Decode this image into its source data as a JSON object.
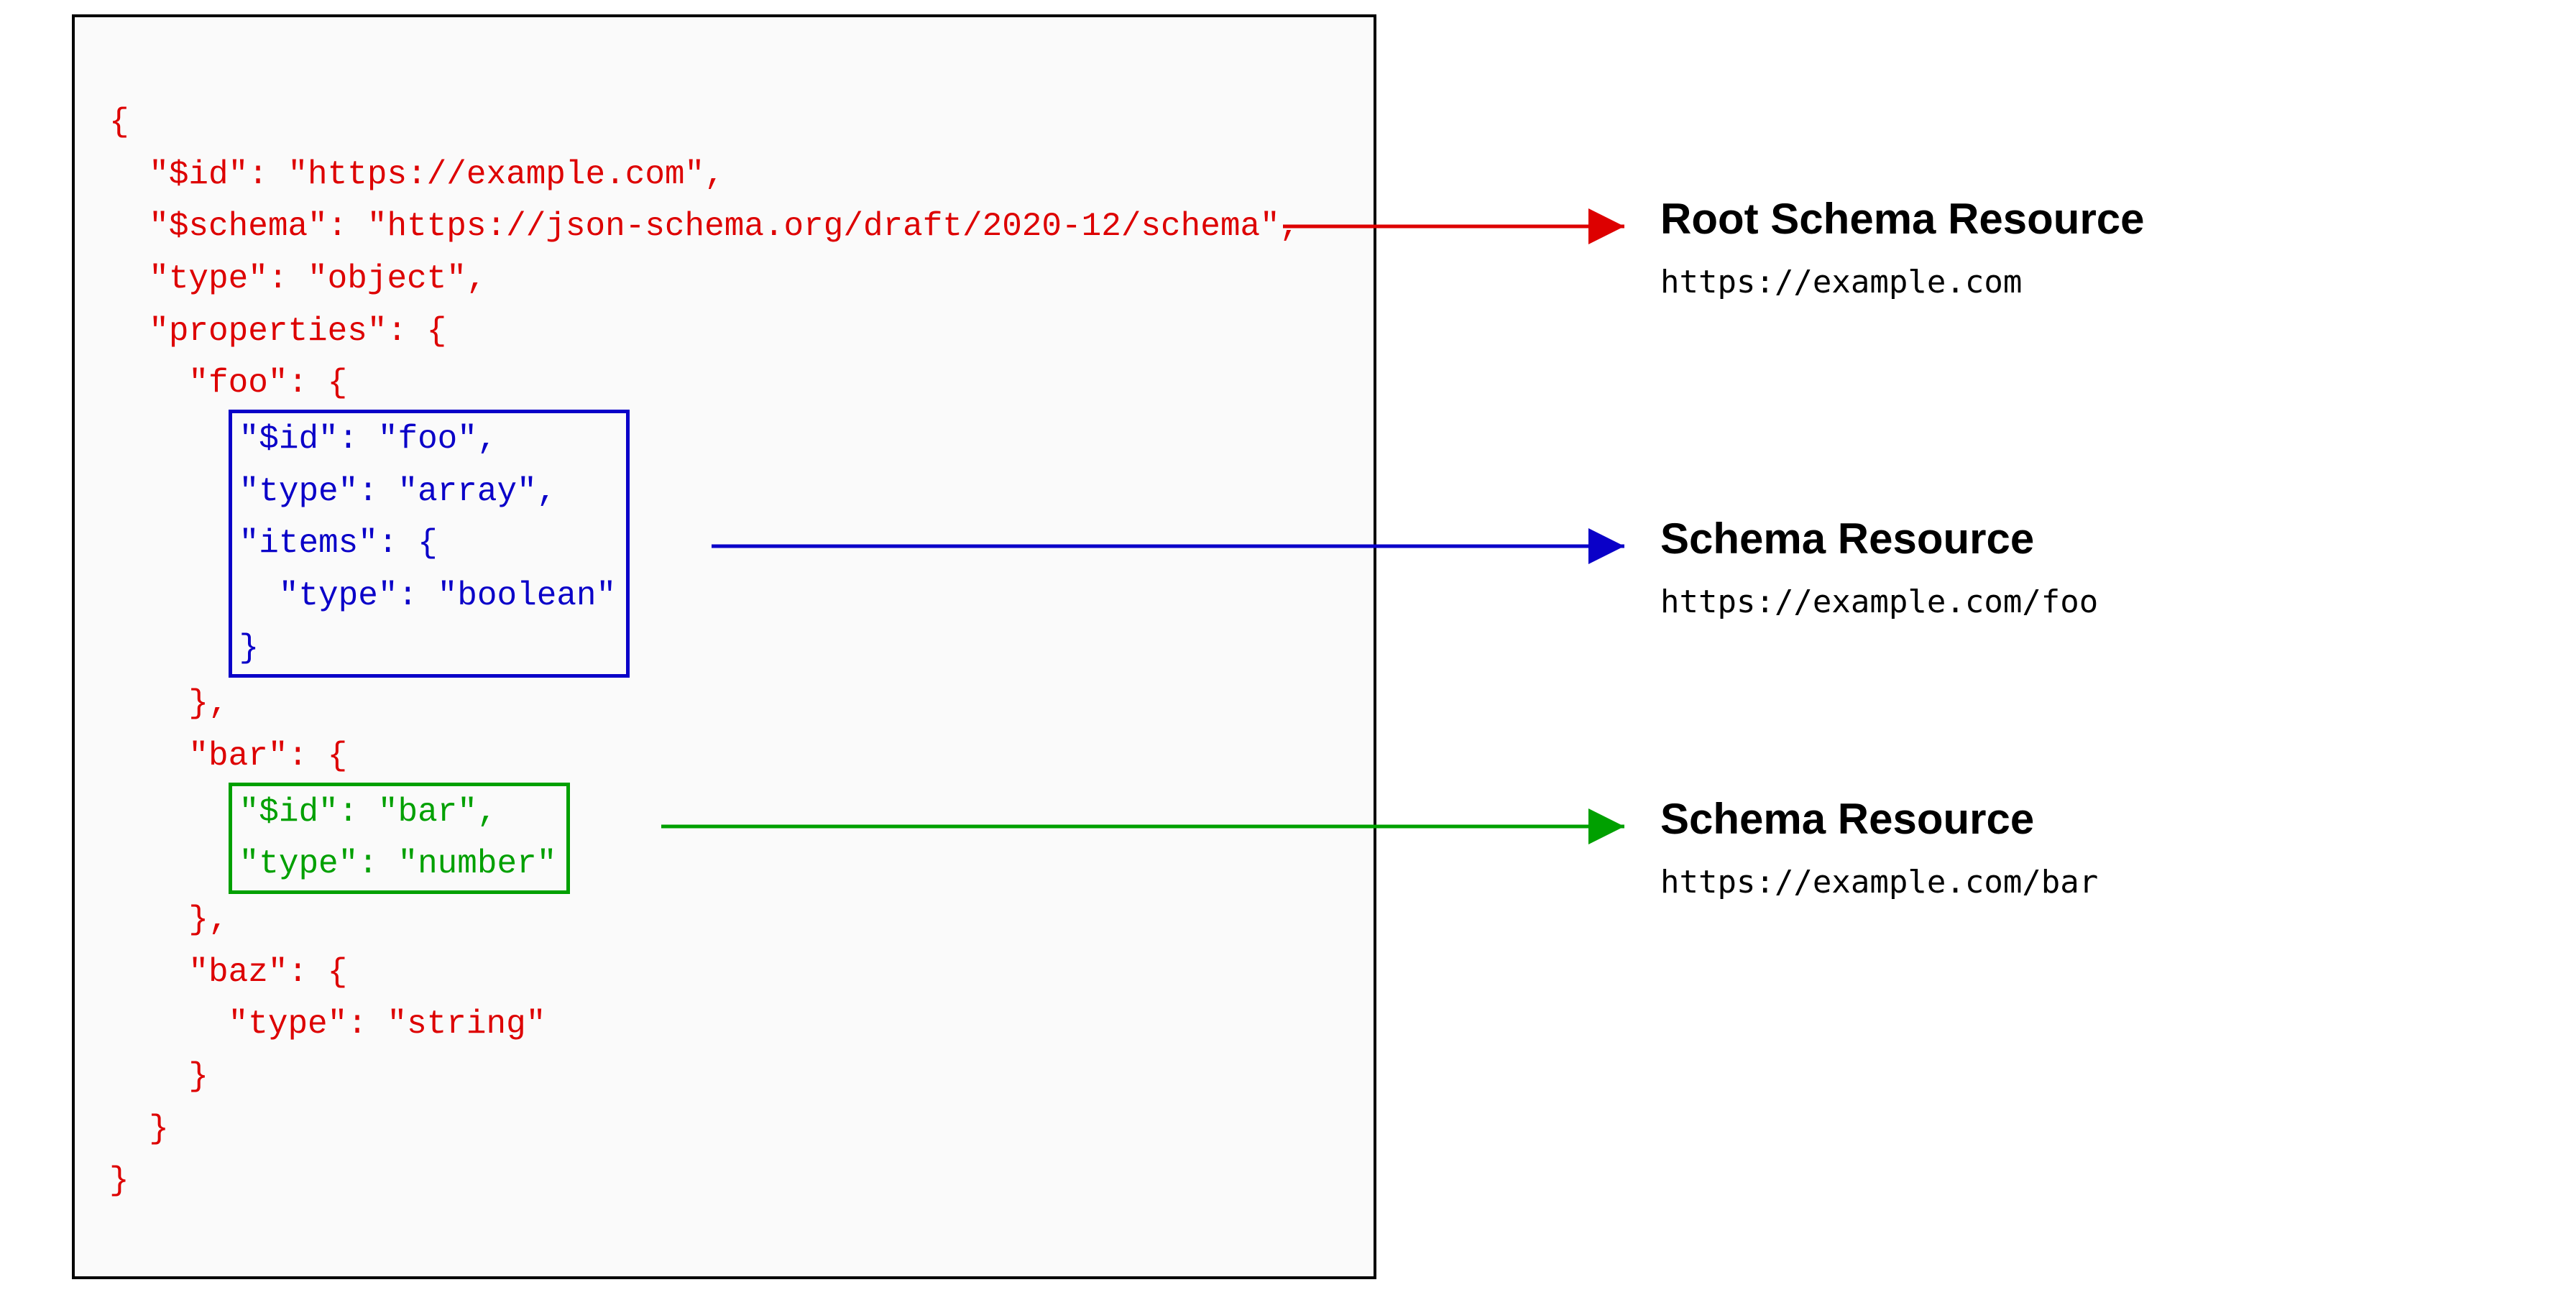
{
  "code": {
    "line1": "{",
    "line2": "  \"$id\": \"https://example.com\",",
    "line3": "  \"$schema\": \"https://json-schema.org/draft/2020-12/schema\",",
    "line4": "  \"type\": \"object\",",
    "line5": "  \"properties\": {",
    "line6": "    \"foo\": {",
    "blue1": "\"$id\": \"foo\",",
    "blue2": "\"type\": \"array\",",
    "blue3": "\"items\": {",
    "blue4": "  \"type\": \"boolean\"",
    "blue5": "}",
    "line7": "    },",
    "line8": "    \"bar\": {",
    "green1": "\"$id\": \"bar\",",
    "green2": "\"type\": \"number\"",
    "line9": "    },",
    "line10": "    \"baz\": {",
    "line11": "      \"type\": \"string\"",
    "line12": "    }",
    "line13": "  }",
    "line14": "}"
  },
  "labels": {
    "root": {
      "title": "Root Schema Resource",
      "url": "https://example.com"
    },
    "foo": {
      "title": "Schema Resource",
      "url": "https://example.com/foo"
    },
    "bar": {
      "title": "Schema Resource",
      "url": "https://example.com/bar"
    }
  },
  "arrowColors": {
    "red": "#dd0000",
    "blue": "#0a00c8",
    "green": "#00a000"
  }
}
